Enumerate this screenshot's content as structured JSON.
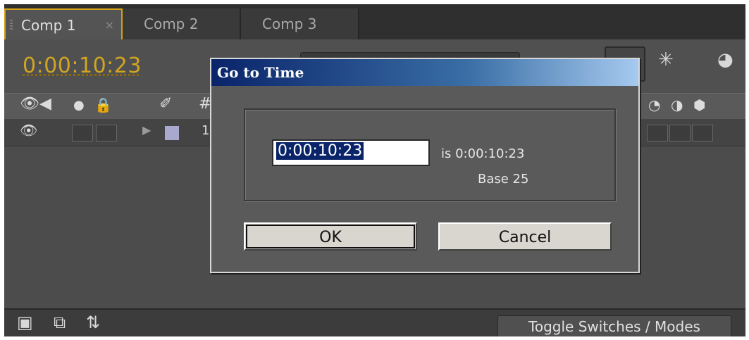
{
  "tabs": [
    {
      "label": "Comp 1",
      "close": "×"
    },
    {
      "label": "Comp 2"
    },
    {
      "label": "Comp 3"
    }
  ],
  "timeline": {
    "timecode": "0:00:10:23",
    "hash_symbol": "#",
    "number": "1"
  },
  "dialog": {
    "title": "Go to Time",
    "input_value": "0:00:10:23",
    "is_text": "is 0:00:10:23",
    "base_text": "Base 25",
    "ok_label": "OK",
    "cancel_label": "Cancel"
  },
  "bottom_bar": {
    "toggle_label": "Toggle Switches / Modes"
  },
  "icons": {
    "eye": "eye-icon",
    "speaker": "speaker-icon",
    "solo": "solo-icon",
    "lock": "lock-icon",
    "label": "label-tag-icon",
    "draft3d": "draft-3d-icon",
    "motion_blur": "motion-blur-icon"
  },
  "colors": {
    "timecode": "#d2a521",
    "dialog_title_start": "#0a246a",
    "dialog_title_end": "#a6caf0",
    "selection": "#0a246a",
    "panel": "#4f4f4f"
  }
}
